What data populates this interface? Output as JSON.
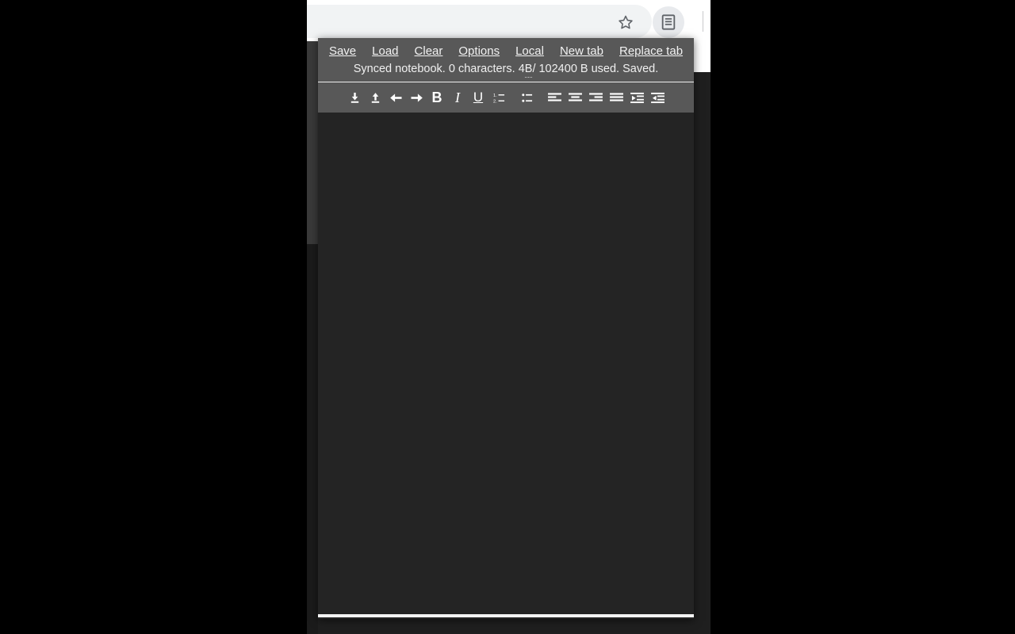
{
  "browser": {
    "bookmark_icon": "star-outline-icon",
    "extension_icon": "notebook-document-icon",
    "extension_title": "Synced Notebook"
  },
  "popup": {
    "menu": [
      {
        "label": "Save",
        "name": "save"
      },
      {
        "label": "Load",
        "name": "load"
      },
      {
        "label": "Clear",
        "name": "clear"
      },
      {
        "label": "Options",
        "name": "options"
      },
      {
        "label": "Local",
        "name": "local"
      },
      {
        "label": "New tab",
        "name": "new-tab"
      },
      {
        "label": "Replace tab",
        "name": "replace-tab"
      }
    ],
    "status": {
      "prefix": "Synced notebook. 0 characters. 4 ",
      "unit": "B",
      "suffix": " / 102400 B used. Saved.",
      "full": "Synced notebook. 0 characters. 4 B / 102400 B used. Saved.",
      "characters": "0",
      "used_bytes": "4",
      "quota_bytes": "102400",
      "state": "Saved."
    },
    "toolbar": [
      {
        "name": "download-icon",
        "icon": "download",
        "title": "Download"
      },
      {
        "name": "upload-icon",
        "icon": "upload",
        "title": "Upload"
      },
      {
        "name": "arrow-left-icon",
        "icon": "arrow-left",
        "title": "Undo"
      },
      {
        "name": "arrow-right-icon",
        "icon": "arrow-right",
        "title": "Redo"
      },
      {
        "name": "bold-icon",
        "icon": "bold",
        "title": "Bold",
        "glyph": "B"
      },
      {
        "name": "italic-icon",
        "icon": "italic",
        "title": "Italic",
        "glyph": "I"
      },
      {
        "name": "underline-icon",
        "icon": "underline",
        "title": "Underline",
        "glyph": "U"
      },
      {
        "name": "numbered-list-icon",
        "icon": "numbered-list",
        "title": "Numbered list"
      },
      {
        "name": "bullet-list-icon",
        "icon": "bullet-list",
        "title": "Bulleted list"
      },
      {
        "name": "align-left-icon",
        "icon": "align-left",
        "title": "Align left"
      },
      {
        "name": "align-center-icon",
        "icon": "align-center",
        "title": "Align center"
      },
      {
        "name": "align-right-icon",
        "icon": "align-right",
        "title": "Align right"
      },
      {
        "name": "align-justify-icon",
        "icon": "align-justify",
        "title": "Justify"
      },
      {
        "name": "indent-icon",
        "icon": "indent",
        "title": "Indent"
      },
      {
        "name": "outdent-icon",
        "icon": "outdent",
        "title": "Outdent"
      }
    ],
    "editor": {
      "content": "",
      "placeholder": ""
    }
  },
  "colors": {
    "popup_header": "#585858",
    "popup_body": "#242424",
    "menu_text": "#f2f2f2",
    "page_dark": "#1f1f1f",
    "browser_chrome": "#ffffff"
  }
}
